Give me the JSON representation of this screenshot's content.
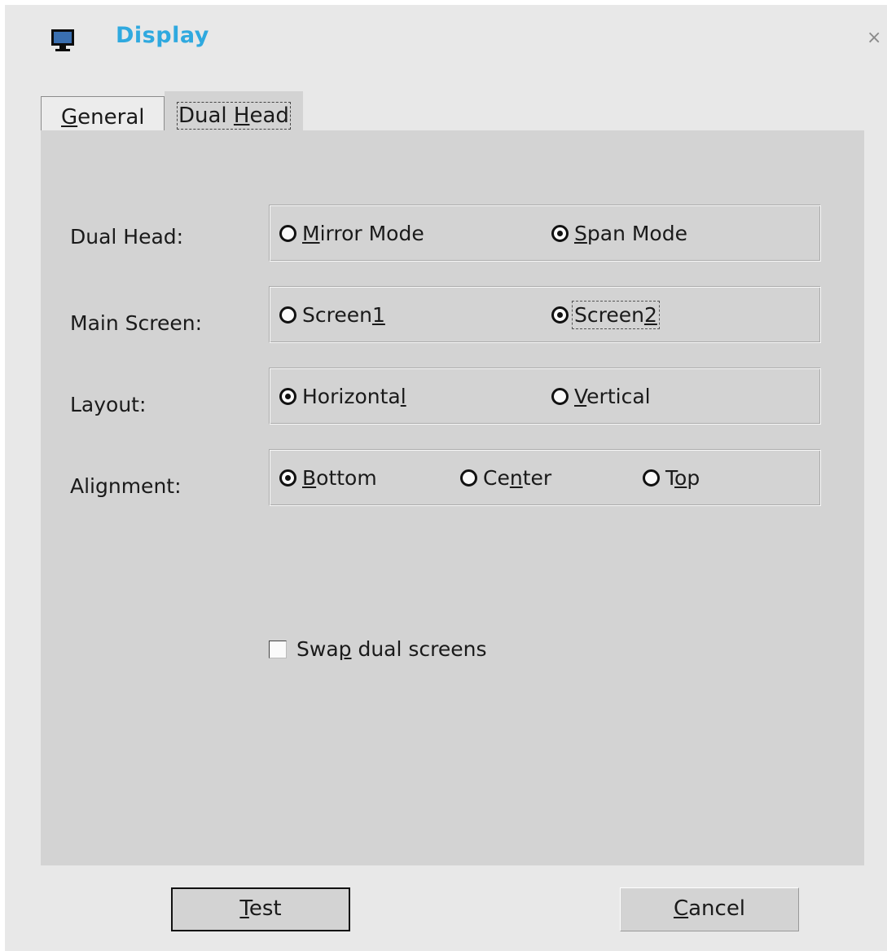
{
  "window": {
    "title": "Display",
    "icon": "monitor-icon",
    "close_glyph": "×",
    "accent_color": "#2fa9df"
  },
  "tabs": [
    {
      "label_pre": "",
      "label_key": "G",
      "label_post": "eneral",
      "selected": false
    },
    {
      "label_pre": "Dual ",
      "label_key": "H",
      "label_post": "ead",
      "selected": true
    }
  ],
  "dual_head": {
    "label": "Dual Head:",
    "options": [
      {
        "pre": "",
        "key": "M",
        "post": "irror Mode",
        "checked": false
      },
      {
        "pre": "",
        "key": "S",
        "post": "pan Mode",
        "checked": true
      }
    ]
  },
  "main_screen": {
    "label": "Main Screen:",
    "options": [
      {
        "pre": "Screen",
        "key": "1",
        "post": "",
        "checked": false
      },
      {
        "pre": "Screen",
        "key": "2",
        "post": "",
        "checked": true
      }
    ]
  },
  "layout": {
    "label": "Layout:",
    "options": [
      {
        "pre": "Horizonta",
        "key": "l",
        "post": "",
        "checked": true
      },
      {
        "pre": "",
        "key": "V",
        "post": "ertical",
        "checked": false
      }
    ]
  },
  "alignment": {
    "label": "Alignment:",
    "options": [
      {
        "pre": "",
        "key": "B",
        "post": "ottom",
        "checked": true
      },
      {
        "pre": "Ce",
        "key": "n",
        "post": "ter",
        "checked": false
      },
      {
        "pre": "T",
        "key": "o",
        "post": "p",
        "checked": false
      }
    ]
  },
  "swap": {
    "pre": "Swa",
    "key": "p",
    "post": " dual screens",
    "checked": false
  },
  "buttons": {
    "test": {
      "pre": "",
      "key": "T",
      "post": "est"
    },
    "cancel": {
      "pre": "",
      "key": "C",
      "post": "ancel"
    }
  }
}
